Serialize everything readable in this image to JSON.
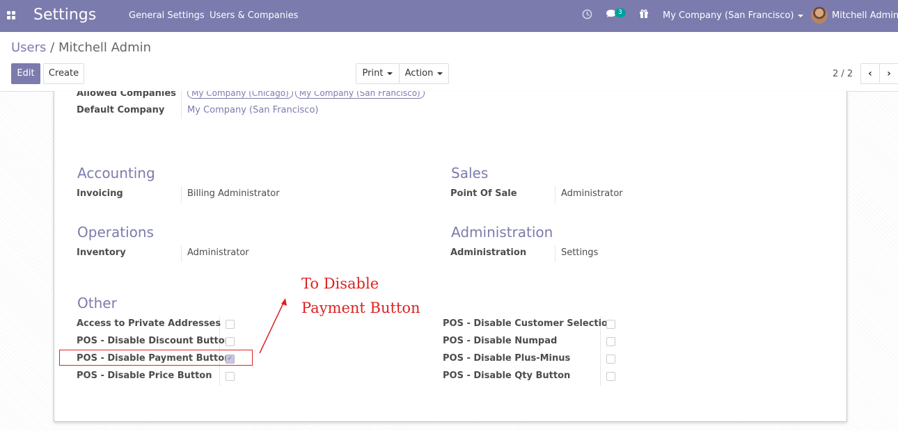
{
  "navbar": {
    "app_title": "Settings",
    "menu": [
      "General Settings",
      "Users & Companies"
    ],
    "icons": [
      "apps-grid-icon",
      "clock-icon",
      "chat-icon",
      "gift-icon"
    ],
    "chat_badge": "3",
    "company": "My Company (San Francisco)",
    "user": "Mitchell Admin"
  },
  "breadcrumb": {
    "parent": "Users",
    "separator": "/",
    "current": "Mitchell Admin"
  },
  "buttons": {
    "edit": "Edit",
    "create": "Create",
    "print": "Print",
    "action": "Action"
  },
  "pager": {
    "value": "2 / 2",
    "prev_icon": "chevron-left-icon",
    "next_icon": "chevron-right-icon"
  },
  "form": {
    "allowed_companies_label": "Allowed Companies",
    "allowed_companies": [
      "My Company (Chicago)",
      "My Company (San Francisco)"
    ],
    "default_company_label": "Default Company",
    "default_company": "My Company (San Francisco)",
    "sections": {
      "accounting": {
        "title": "Accounting",
        "field": "Invoicing",
        "value": "Billing Administrator"
      },
      "sales": {
        "title": "Sales",
        "field": "Point Of Sale",
        "value": "Administrator"
      },
      "operations": {
        "title": "Operations",
        "field": "Inventory",
        "value": "Administrator"
      },
      "administration": {
        "title": "Administration",
        "field": "Administration",
        "value": "Settings"
      }
    },
    "other": {
      "title": "Other",
      "left": [
        {
          "label": "Access to Private Addresses",
          "checked": false
        },
        {
          "label": "POS - Disable Discount Button",
          "checked": false
        },
        {
          "label": "POS - Disable Payment Button",
          "checked": true
        },
        {
          "label": "POS - Disable Price Button",
          "checked": false
        }
      ],
      "right": [
        {
          "label": "POS - Disable Customer Selection",
          "checked": false
        },
        {
          "label": "POS - Disable Numpad",
          "checked": false
        },
        {
          "label": "POS - Disable Plus-Minus",
          "checked": false
        },
        {
          "label": "POS - Disable Qty Button",
          "checked": false
        }
      ]
    }
  },
  "annotation": {
    "line1": "To Disable",
    "line2": "Payment Button",
    "color": "#e02020"
  },
  "colors": {
    "brand": "#7c7bad",
    "badge": "#00a09d"
  }
}
